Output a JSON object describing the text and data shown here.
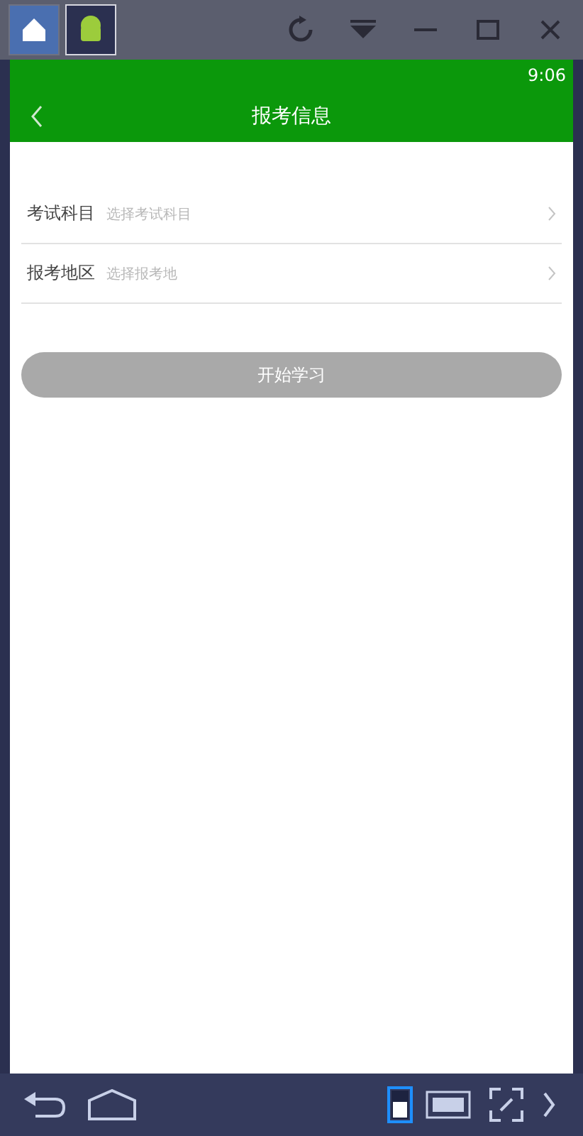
{
  "emulator": {
    "tabs": [
      {
        "kind": "home",
        "selected": false
      },
      {
        "kind": "app",
        "selected": true
      }
    ]
  },
  "status_bar": {
    "time": "9:06"
  },
  "app_bar": {
    "title": "报考信息"
  },
  "form": {
    "rows": [
      {
        "label": "考试科目",
        "placeholder": "选择考试科目"
      },
      {
        "label": "报考地区",
        "placeholder": "选择报考地"
      }
    ]
  },
  "start_button": {
    "label": "开始学习",
    "disabled": true
  },
  "nav_bar": {
    "buttons": [
      {
        "kind": "back",
        "selected": false
      },
      {
        "kind": "home",
        "selected": false
      },
      {
        "kind": "portrait",
        "selected": true
      },
      {
        "kind": "keyboard",
        "selected": false
      },
      {
        "kind": "fullscreen",
        "selected": false
      },
      {
        "kind": "more",
        "selected": false
      }
    ]
  }
}
